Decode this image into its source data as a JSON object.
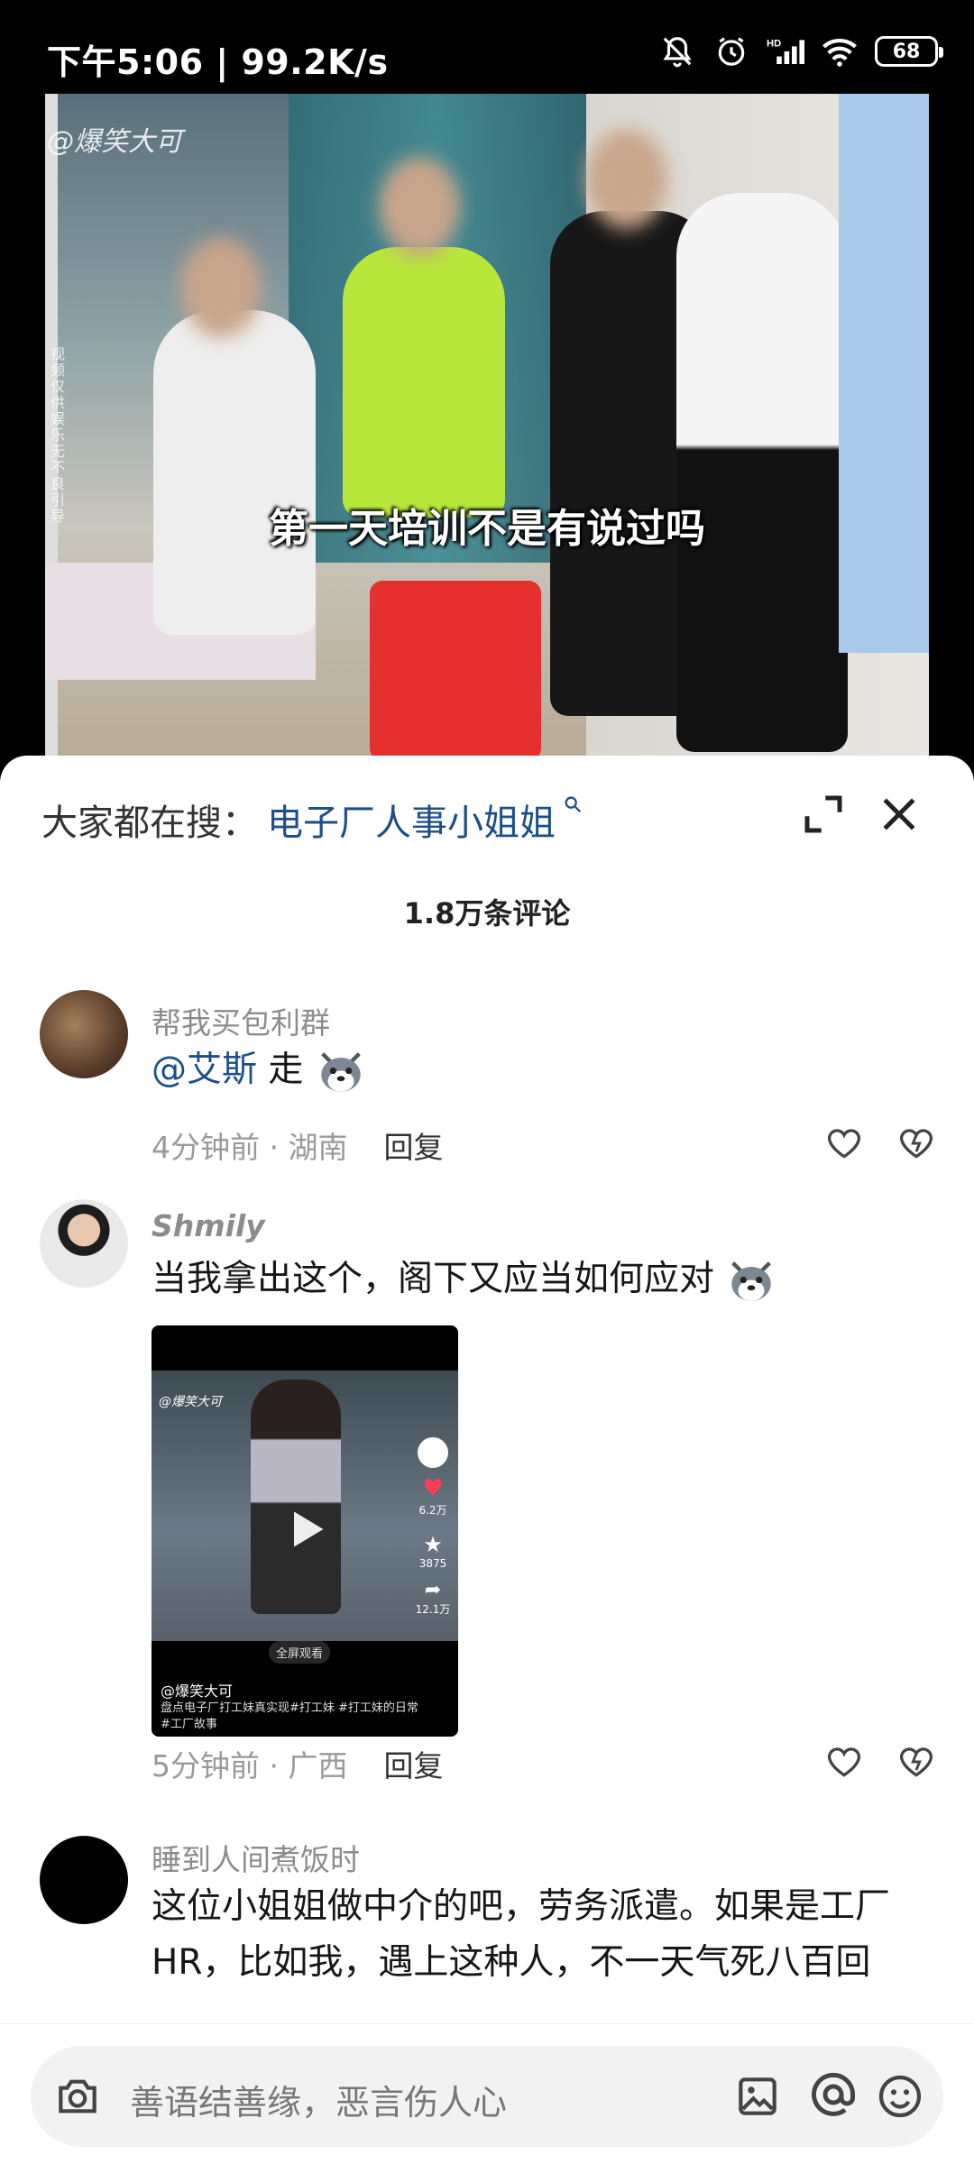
{
  "status_bar": {
    "time_speed": "下午5:06 | 99.2K/s",
    "battery": "68"
  },
  "video": {
    "subtitle": "第一天培训不是有说过吗",
    "watermark": "@爆笑大可",
    "side_watermark": "视频仅供娱乐 无不良引导"
  },
  "sheet": {
    "search_prefix": "大家都在搜：",
    "search_keyword": "电子厂人事小姐姐",
    "comment_count": "1.8万条评论"
  },
  "comments": [
    {
      "username": "帮我买包利群",
      "mention": "@艾斯",
      "text": " 走",
      "time_location": "4分钟前 · 湖南",
      "reply": "回复"
    },
    {
      "username": "Shmily",
      "text": "当我拿出这个，阁下又应当如何应对",
      "time_location": "5分钟前 · 广西",
      "reply": "回复",
      "video_thumb": {
        "watermark": "@爆笑大可",
        "fullscreen": "全屏观看",
        "account": "@爆笑大可",
        "description": "盘点电子厂打工妹真实现#打工妹 #打工妹的日常 #工厂故事",
        "likes": "6.2万",
        "stars": "3875",
        "shares": "12.1万"
      }
    },
    {
      "username": "睡到人间煮饭时",
      "text": "这位小姐姐做中介的吧，劳务派遣。如果是工厂HR，比如我，遇上这种人，不一天气死八百回"
    }
  ],
  "input": {
    "placeholder": "善语结善缘，恶言伤人心"
  },
  "colors": {
    "link_blue": "#1b4f8a",
    "meta_gray": "#9a9a9a"
  }
}
